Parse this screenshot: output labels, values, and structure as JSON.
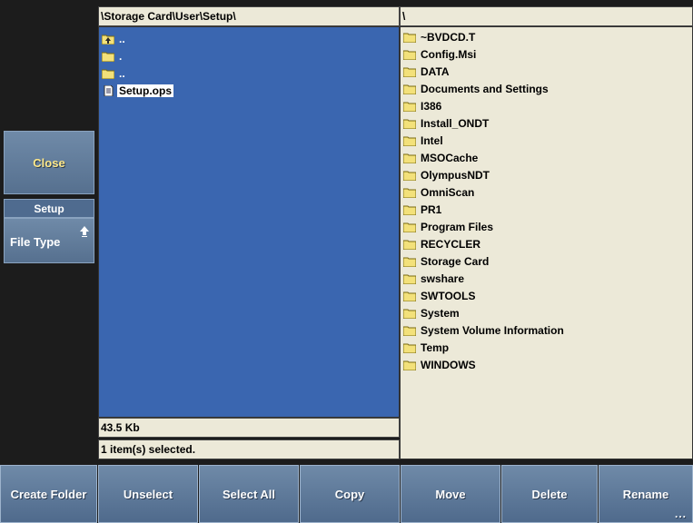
{
  "side_panel": {
    "close_label": "Close",
    "group_title": "Setup",
    "file_type_label": "File Type"
  },
  "left_pane": {
    "path": "\\Storage Card\\User\\Setup\\",
    "items": [
      {
        "name": "..",
        "icon": "folder-up-icon"
      },
      {
        "name": ".",
        "icon": "folder-icon"
      },
      {
        "name": "..",
        "icon": "folder-icon"
      },
      {
        "name": "Setup.ops",
        "icon": "file-icon",
        "selected": true
      }
    ],
    "size_text": "43.5 Kb",
    "selection_text": "1 item(s) selected."
  },
  "right_pane": {
    "path": "\\",
    "items": [
      "~BVDCD.T",
      "Config.Msi",
      "DATA",
      "Documents and Settings",
      "I386",
      "Install_ONDT",
      "Intel",
      "MSOCache",
      "OlympusNDT",
      "OmniScan",
      "PR1",
      "Program Files",
      "RECYCLER",
      "Storage Card",
      "swshare",
      "SWTOOLS",
      "System",
      "System Volume Information",
      "Temp",
      "WINDOWS"
    ]
  },
  "toolbar": {
    "create_folder": "Create Folder",
    "unselect": "Unselect",
    "select_all": "Select All",
    "copy": "Copy",
    "move": "Move",
    "delete": "Delete",
    "rename": "Rename",
    "more": "..."
  },
  "colors": {
    "pane_blue": "#3a66b0",
    "button_blue": "#5f7a9b",
    "close_text": "#ffe98a",
    "panel_beige": "#ece9d8"
  }
}
